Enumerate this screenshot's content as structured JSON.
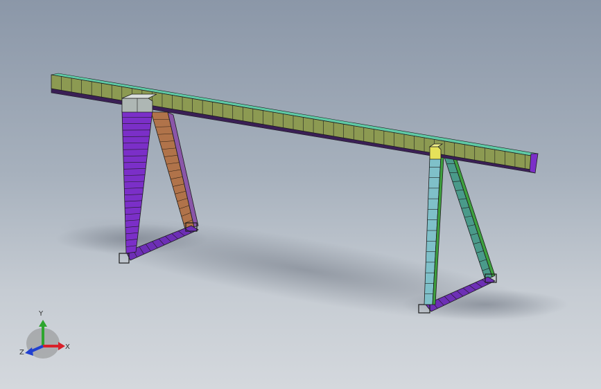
{
  "triad": {
    "x_label": "X",
    "y_label": "Y",
    "z_label": "Z",
    "x_color": "#d8202a",
    "y_color": "#2ea52e",
    "z_color": "#2040d0"
  },
  "model": {
    "beam_color": "#8c9a52",
    "beam_top_color": "#5fc9a5",
    "left_leg_front_color": "#7b2fc8",
    "left_leg_back_color": "#b0734a",
    "right_leg_front_color": "#7fc0c9",
    "right_leg_back_color": "#4a9a8a",
    "base_color": "#6d2fb5",
    "mesh_line_color": "#1c1c1c"
  }
}
